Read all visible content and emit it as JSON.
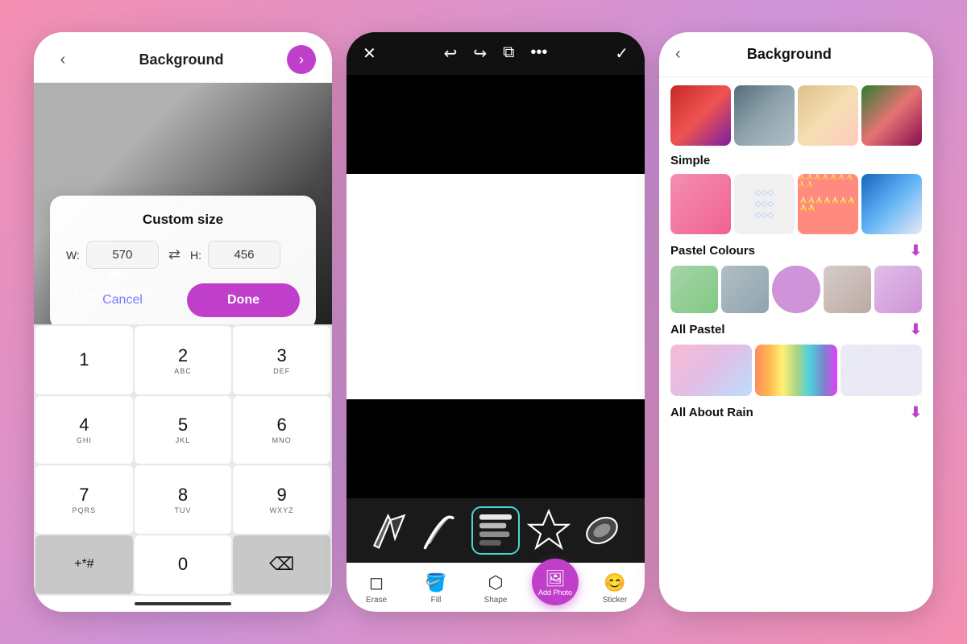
{
  "panel1": {
    "title": "Background",
    "back_label": "‹",
    "next_label": "›",
    "dialog": {
      "title": "Custom size",
      "width_label": "W:",
      "width_value": "570",
      "height_label": "H:",
      "height_value": "456",
      "cancel_label": "Cancel",
      "done_label": "Done"
    },
    "draw_on_photo": "Draw on Photo",
    "numpad": {
      "keys": [
        {
          "num": "1",
          "letters": ""
        },
        {
          "num": "2",
          "letters": "ABC"
        },
        {
          "num": "3",
          "letters": "DEF"
        },
        {
          "num": "4",
          "letters": "GHI"
        },
        {
          "num": "5",
          "letters": "JKL"
        },
        {
          "num": "6",
          "letters": "MNO"
        },
        {
          "num": "7",
          "letters": "PQRS"
        },
        {
          "num": "8",
          "letters": "TUV"
        },
        {
          "num": "9",
          "letters": "WXYZ"
        },
        {
          "num": "+*#",
          "letters": ""
        },
        {
          "num": "0",
          "letters": ""
        },
        {
          "num": "⌫",
          "letters": ""
        }
      ]
    }
  },
  "panel2": {
    "header_icons": [
      "✕",
      "↩",
      "↪",
      "⧉",
      "•••",
      "✓"
    ],
    "tools": [
      {
        "label": "Erase",
        "icon": "◻"
      },
      {
        "label": "Fill",
        "icon": "🪣"
      },
      {
        "label": "Shape",
        "icon": "⬡"
      },
      {
        "label": "Add Photo",
        "icon": "🖼"
      },
      {
        "label": "Sticker",
        "icon": "😊"
      }
    ]
  },
  "panel3": {
    "title": "Background",
    "back_label": "‹",
    "sections": [
      {
        "title": "Simple",
        "has_download": false
      },
      {
        "title": "Pastel Colours",
        "has_download": true
      },
      {
        "title": "All Pastel",
        "has_download": true
      },
      {
        "title": "All About Rain",
        "has_download": true
      }
    ]
  }
}
